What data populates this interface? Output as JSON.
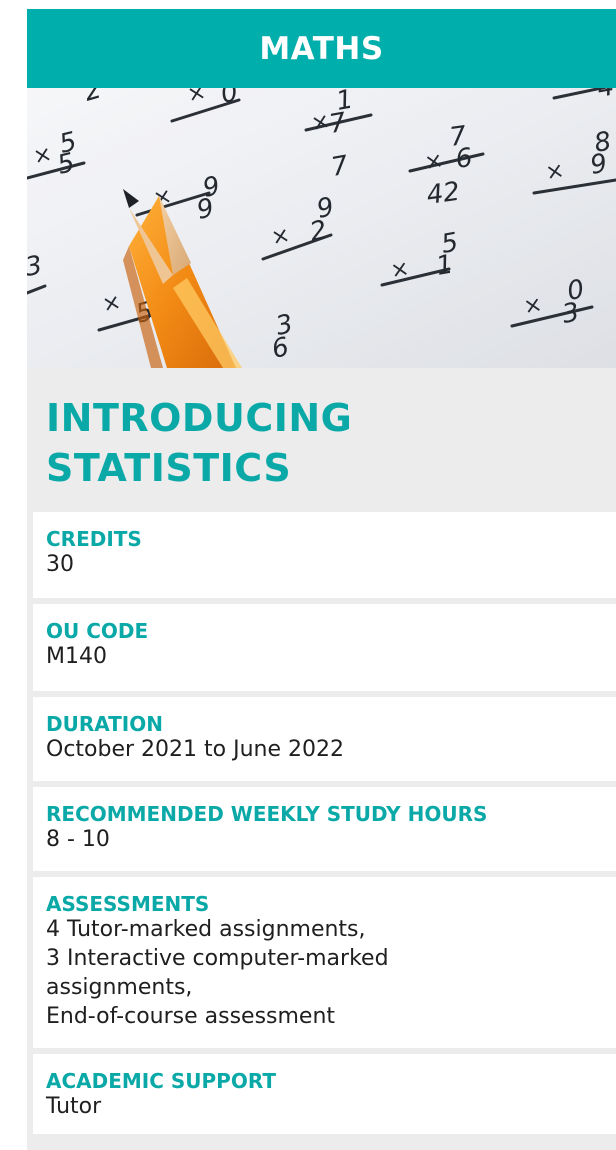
{
  "header": {
    "subject": "MATHS"
  },
  "course": {
    "title": "INTRODUCING STATISTICS"
  },
  "hero_image": {
    "description_icon": "maths-worksheet-pencil-image",
    "numbers": [
      "2",
      "0",
      "5",
      "5",
      "1",
      "7",
      "7",
      "7",
      "6",
      "42",
      "4",
      "8",
      "9",
      "9",
      "9",
      "9",
      "2",
      "5",
      "1",
      "3",
      "5",
      "3",
      "6",
      "0",
      "3"
    ]
  },
  "details": [
    {
      "label": "CREDITS",
      "value_lines": [
        "30"
      ]
    },
    {
      "label": "OU CODE",
      "value_lines": [
        "M140"
      ]
    },
    {
      "label": "DURATION",
      "value_lines": [
        "October 2021 to June 2022"
      ]
    },
    {
      "label": "RECOMMENDED WEEKLY STUDY HOURS",
      "value_lines": [
        "8 - 10"
      ]
    },
    {
      "label": "ASSESSMENTS",
      "value_lines": [
        "4 Tutor-marked assignments,",
        "3 Interactive computer-marked",
        "assignments,",
        "End-of-course assessment"
      ]
    },
    {
      "label": "ACADEMIC SUPPORT",
      "value_lines": [
        "Tutor"
      ]
    }
  ],
  "colors": {
    "brand": "#00aeab",
    "accent_text": "#0aa9a7",
    "card_background": "#ececec",
    "body_text": "#1f1f1f"
  }
}
